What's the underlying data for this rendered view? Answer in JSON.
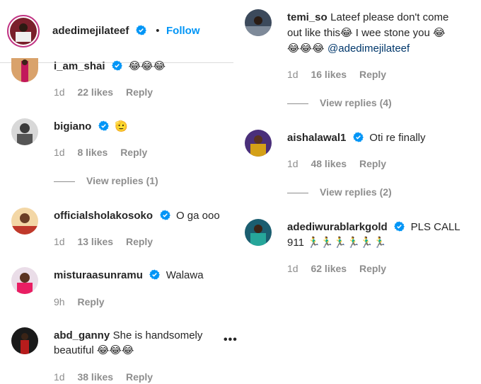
{
  "post_header": {
    "username": "adedimejilateef",
    "separator": "•",
    "follow_label": "Follow"
  },
  "left_comments": [
    {
      "username": "i_am_shai",
      "text": "😂😂😂",
      "time": "1d",
      "likes": "22 likes",
      "reply": "Reply"
    },
    {
      "username": "bigiano",
      "text": "🫡",
      "time": "1d",
      "likes": "8 likes",
      "reply": "Reply",
      "view_replies": "View replies (1)"
    },
    {
      "username": "officialsholakosoko",
      "text": "O ga ooo",
      "time": "1d",
      "likes": "13 likes",
      "reply": "Reply"
    },
    {
      "username": "misturaasunramu",
      "text": "Walawa",
      "time": "9h",
      "reply": "Reply"
    },
    {
      "username": "abd_ganny",
      "text_line1": "She is handsomely",
      "text_line2": "beautiful 😂😂😂",
      "time": "1d",
      "likes": "38 likes",
      "reply": "Reply",
      "more": "•••"
    }
  ],
  "right_comments": [
    {
      "username": "temi_so",
      "text_line1": "Lateef please don't come",
      "text_line2": "out like this😂 I wee stone you 😂",
      "text_line3": "😂😂😂",
      "mention": "@adedimejilateef",
      "time": "1d",
      "likes": "16 likes",
      "reply": "Reply",
      "view_replies": "View replies (4)"
    },
    {
      "username": "aishalawal1",
      "text": "Oti re finally",
      "time": "1d",
      "likes": "48 likes",
      "reply": "Reply",
      "view_replies": "View replies (2)"
    },
    {
      "username": "adediwurablarkgold",
      "text_line1": "PLS CALL",
      "text_line2": "911 🏃‍♂️🏃‍♂️🏃‍♂️🏃‍♂️🏃‍♂️🏃‍♂️",
      "time": "1d",
      "likes": "62 likes",
      "reply": "Reply"
    }
  ],
  "colors": {
    "follow": "#0095f6",
    "verified": "#0095f6",
    "secondary_text": "#8e8e8e",
    "mention": "#00376b"
  }
}
